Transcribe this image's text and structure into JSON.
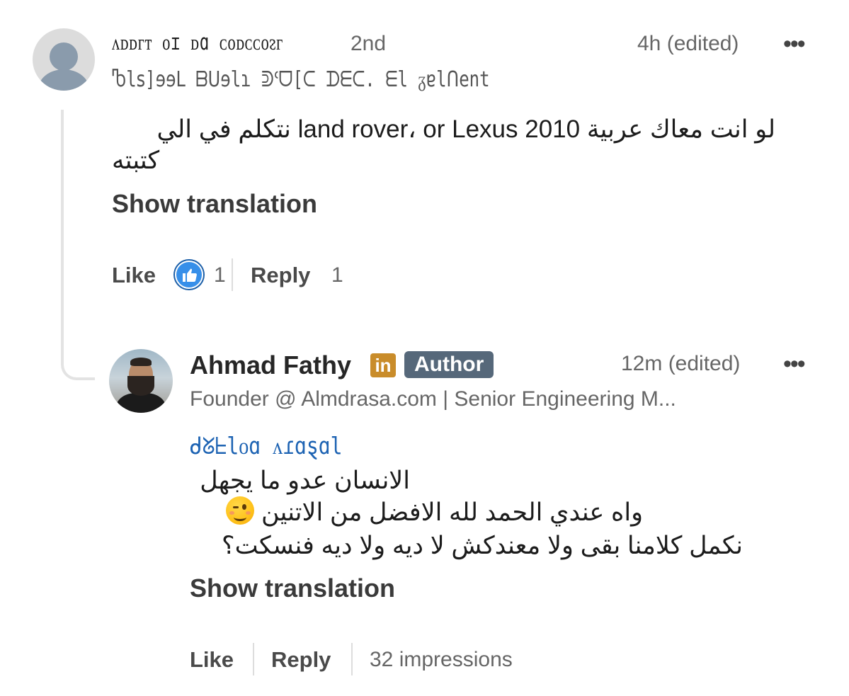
{
  "comment": {
    "author_name": "ᴧᴅᴅᴦᴛ ᴏɪ ᴅɑ ᴄᴏᴅᴄᴄᴏᴤᴦ",
    "degree": "2nd",
    "timestamp": "4h (edited)",
    "headline": "Ⴊlꜱ]ɘɘᒪ ᗷᑌɘlɿ ᕲᒼᗜ[ᑕ ᗪᗴᑕ. ᗴl ᵹɐlᑎent",
    "text_line1": "لو انت معاك عربية land rover، or Lexus 2010 نتكلم في الي",
    "text_line2": "كتبته",
    "show_translation": "Show translation",
    "like_label": "Like",
    "like_count": "1",
    "reply_label": "Reply",
    "reply_count": "1"
  },
  "reply": {
    "author_name": "Ahmad Fathy",
    "linkedin_badge": "in",
    "author_badge": "Author",
    "timestamp": "12m (edited)",
    "headline": "Founder @ Almdrasa.com | Senior Engineering M...",
    "mention": "ᑯᘜᖶlᴏɑ ᴧɾɑȿɑl",
    "line1": "الانسان عدو ما يجهل",
    "line2": "واه عندي الحمد لله الافضل من الاتنين",
    "line3": "نكمل كلامنا بقى ولا معندكش لا ديه ولا ديه فنسكت؟",
    "show_translation": "Show translation",
    "like_label": "Like",
    "reply_label": "Reply",
    "impressions": "32 impressions"
  },
  "icons": {
    "more": "more-horizontal-icon",
    "like_reaction": "like-reaction-icon",
    "wink": "wink-emoji-icon",
    "linkedin": "linkedin-icon"
  },
  "colors": {
    "like_blue": "#378fe9",
    "linkedin_gold": "#c98c2a",
    "author_badge": "#56687a",
    "mention_blue": "#1d63b3"
  }
}
